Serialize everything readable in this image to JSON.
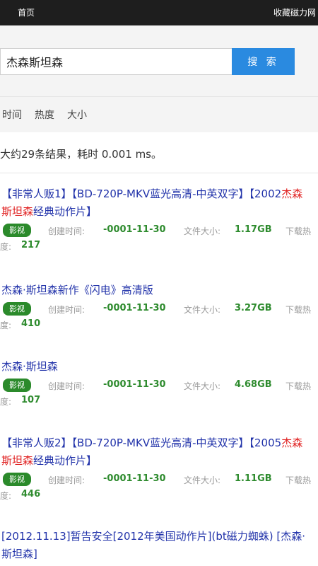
{
  "nav": {
    "home": "首页",
    "favorite": "收藏磁力网"
  },
  "search": {
    "query": "杰森斯坦森",
    "button": "搜 索"
  },
  "sort": [
    "时间",
    "热度",
    "大小"
  ],
  "summary": "大约29条结果，耗时 0.001 ms。",
  "labels": {
    "created": "创建时间:",
    "size": "文件大小:",
    "heat1": "下载热",
    "heat2": "度:"
  },
  "results": [
    {
      "title_parts": [
        "【非常人贩1】【BD-720P-MKV蓝光高清-中英双字】【2002",
        "杰森斯坦森",
        "经典动作片】"
      ],
      "tag": "影视",
      "created": "-0001-11-30",
      "size": "1.17GB",
      "heat": "217"
    },
    {
      "title_parts": [
        "杰森·斯坦森新作《闪电》高清版"
      ],
      "tag": "影视",
      "created": "-0001-11-30",
      "size": "3.27GB",
      "heat": "410"
    },
    {
      "title_parts": [
        "杰森·斯坦森"
      ],
      "tag": "影视",
      "created": "-0001-11-30",
      "size": "4.68GB",
      "heat": "107"
    },
    {
      "title_parts": [
        "【非常人贩2】【BD-720P-MKV蓝光高清-中英双字】【2005",
        "杰森斯坦森",
        "经典动作片】"
      ],
      "tag": "影视",
      "created": "-0001-11-30",
      "size": "1.11GB",
      "heat": "446"
    },
    {
      "title_parts": [
        "[2012.11.13]暂告安全[2012年美国动作片](bt磁力蜘蛛) [杰森·斯坦森]"
      ]
    }
  ]
}
